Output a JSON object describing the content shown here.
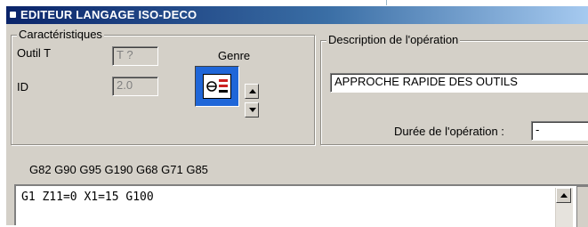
{
  "window": {
    "title": "EDITEUR LANGAGE ISO-DECO"
  },
  "caracteristiques": {
    "caption": "Caractéristiques",
    "outil_label": "Outil T",
    "outil_value": "T ?",
    "id_label": "ID",
    "id_value": "2.0",
    "genre_label": "Genre"
  },
  "operation": {
    "caption": "Description de l'opération",
    "description_value": "APPROCHE RAPIDE DES OUTILS",
    "duree_label": "Durée de l'opération :",
    "duree_value": "-"
  },
  "gcodes": "G82 G90 G95 G190 G68 G71 G85",
  "editor": {
    "line1": "G1 Z11=0 X1=15 G100"
  },
  "colors": {
    "title_start": "#0a246a",
    "title_end": "#a6caf0",
    "genre_bg": "#1f66d8"
  }
}
